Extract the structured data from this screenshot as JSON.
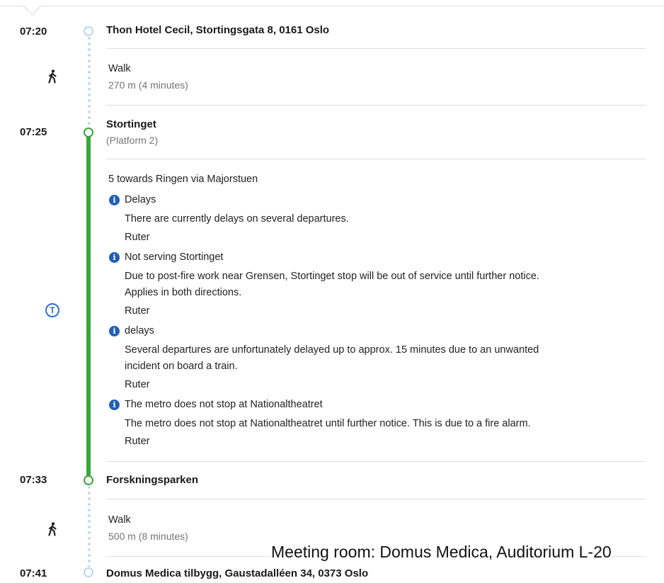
{
  "stops": [
    {
      "time": "07:20",
      "name": "Thon Hotel Cecil, Stortingsgata 8, 0161 Oslo"
    },
    {
      "time": "07:25",
      "name": "Stortinget",
      "detail": "(Platform 2)"
    },
    {
      "time": "07:33",
      "name": "Forskningsparken"
    },
    {
      "time": "07:41",
      "name": "Domus Medica tilbygg, Gaustadalléen 34, 0373 Oslo"
    }
  ],
  "walk1": {
    "mode": "Walk",
    "detail": "270 m (4 minutes)",
    "icon": "walking-person-icon"
  },
  "metro": {
    "icon": "metro-t-icon",
    "line": "5 towards Ringen via Majorstuen",
    "line_color": "#38a63b",
    "alerts": [
      {
        "title": "Delays",
        "lines": [
          "There are currently delays on several departures."
        ],
        "source": "Ruter"
      },
      {
        "title": "Not serving Stortinget",
        "lines": [
          "Due to post-fire work near Grensen, Stortinget stop will be out of service until further notice.",
          "Applies in both directions."
        ],
        "source": "Ruter"
      },
      {
        "title": "delays",
        "lines": [
          "Several departures are unfortunately delayed up to approx. 15 minutes due to an unwanted",
          "incident on board a train."
        ],
        "source": "Ruter"
      },
      {
        "title": "The metro does not stop at Nationaltheatret",
        "lines": [
          "The metro does not stop at Nationaltheatret until further notice. This is due to a fire alarm."
        ],
        "source": "Ruter"
      }
    ]
  },
  "walk2": {
    "mode": "Walk",
    "detail": "500 m (8 minutes)",
    "icon": "walking-person-icon"
  },
  "caption": "Meeting room: Domus Medica, Auditorium L-20"
}
